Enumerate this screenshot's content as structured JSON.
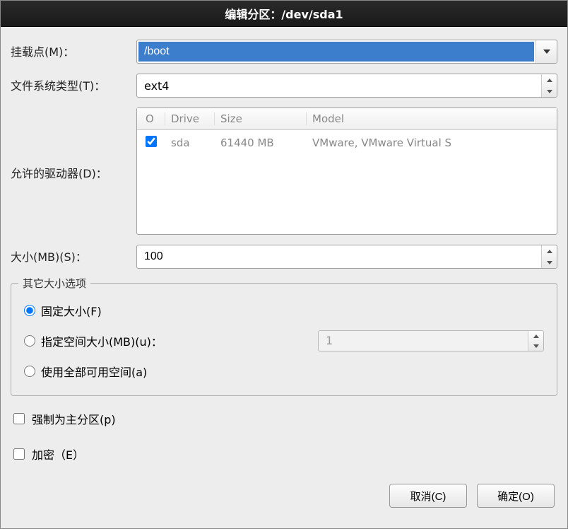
{
  "title": "编辑分区：/dev/sda1",
  "labels": {
    "mount_point": "挂载点(M)：",
    "fs_type": "文件系统类型(T)：",
    "allowed_drives": "允许的驱动器(D)：",
    "size": "大小(MB)(S)：",
    "other_size_options": "其它大小选项",
    "fixed_size": "固定大小(F)",
    "specify_space": "指定空间大小(MB)(u)：",
    "use_all_space": "使用全部可用空间(a)",
    "force_primary": "强制为主分区(p)",
    "encrypt": "加密（E）"
  },
  "values": {
    "mount_point": "/boot",
    "fs_type": "ext4",
    "size": "100",
    "specify_space_val": "1"
  },
  "drives": {
    "headers": {
      "o": "O",
      "drive": "Drive",
      "size": "Size",
      "model": "Model"
    },
    "rows": [
      {
        "checked": true,
        "drive": "sda",
        "size": "61440 MB",
        "model": "VMware, VMware Virtual S"
      }
    ]
  },
  "buttons": {
    "cancel": "取消(C)",
    "ok": "确定(O)"
  }
}
